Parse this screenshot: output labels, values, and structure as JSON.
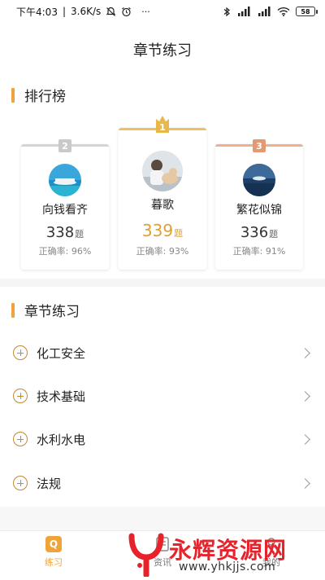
{
  "status_bar": {
    "time": "下午4:03",
    "separator": "|",
    "speed": "3.6K/s",
    "battery": "58",
    "more": "···"
  },
  "page": {
    "title": "章节练习"
  },
  "leaderboard": {
    "heading": "排行榜",
    "score_unit": "题",
    "rate_label": "正确率",
    "entries": [
      {
        "rank": "2",
        "name": "向钱看齐",
        "score": "338",
        "rate": "96%"
      },
      {
        "rank": "1",
        "name": "暮歌",
        "score": "339",
        "rate": "93%"
      },
      {
        "rank": "3",
        "name": "繁花似锦",
        "score": "336",
        "rate": "91%"
      }
    ]
  },
  "chapters": {
    "heading": "章节练习",
    "items": [
      {
        "label": "化工安全"
      },
      {
        "label": "技术基础"
      },
      {
        "label": "水利水电"
      },
      {
        "label": "法规"
      }
    ]
  },
  "bottom_nav": {
    "items": [
      {
        "label": "练习",
        "icon": "Q"
      },
      {
        "label": "资讯"
      },
      {
        "label": "我的"
      }
    ]
  },
  "watermark": {
    "title": "永辉资源网",
    "url": "www.yhkjjs.com"
  },
  "colors": {
    "accent": "#f0a33a",
    "gold_score": "#e0a030",
    "silver": "#c8c8c8",
    "bronze": "#e39a72",
    "watermark_red": "#e8222a"
  }
}
